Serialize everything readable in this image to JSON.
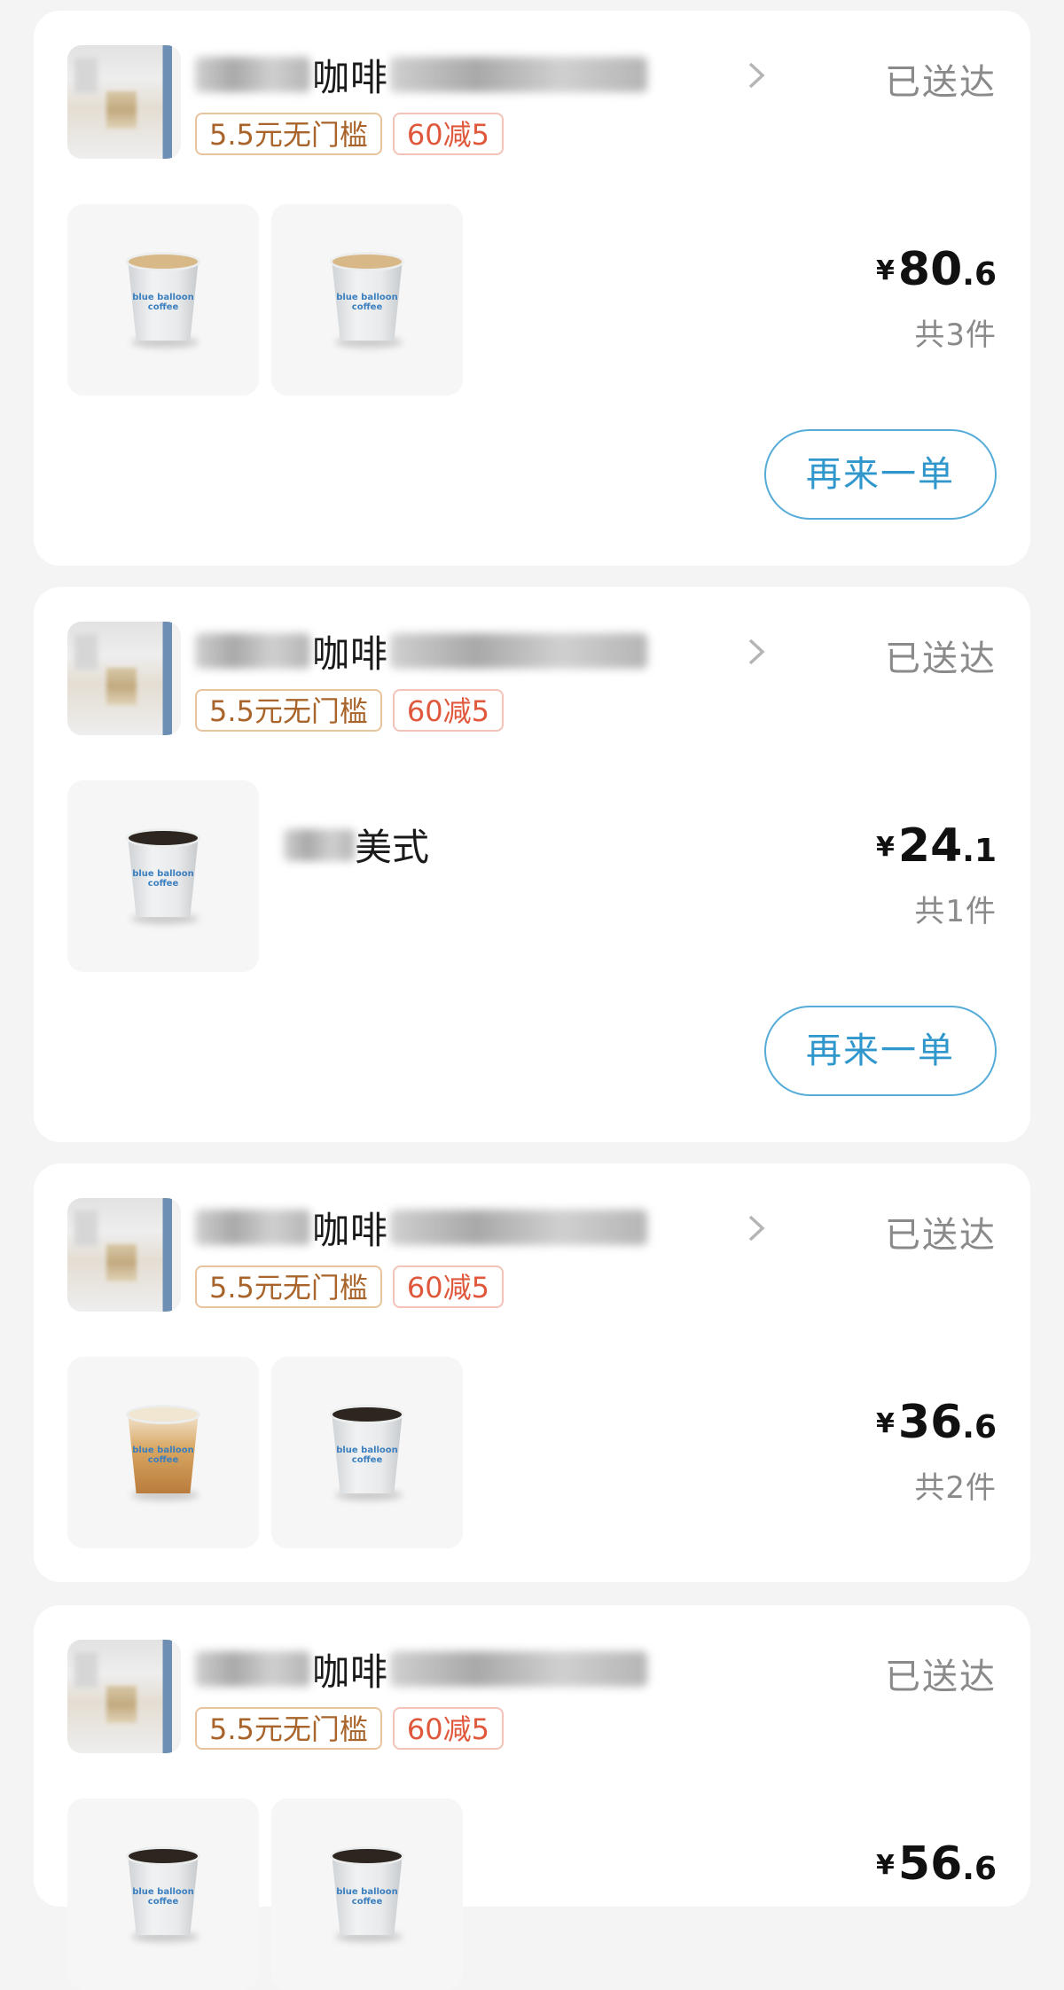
{
  "orders": [
    {
      "shop_name_visible": "咖啡",
      "status": "已送达",
      "tags": [
        "5.5元无门槛",
        "60减5"
      ],
      "price_int": "80",
      "price_dec": ".6",
      "currency": "¥",
      "count": "共3件",
      "reorder": "再来一单",
      "thumbs": [
        "latte-cup",
        "latte-cup"
      ]
    },
    {
      "shop_name_visible": "咖啡",
      "status": "已送达",
      "tags": [
        "5.5元无门槛",
        "60减5"
      ],
      "price_int": "24",
      "price_dec": ".1",
      "currency": "¥",
      "count": "共1件",
      "reorder": "再来一单",
      "item_name_visible": "美式",
      "thumbs": [
        "black-coffee-cup"
      ]
    },
    {
      "shop_name_visible": "咖啡",
      "status": "已送达",
      "tags": [
        "5.5元无门槛",
        "60减5"
      ],
      "price_int": "36",
      "price_dec": ".6",
      "currency": "¥",
      "count": "共2件",
      "thumbs": [
        "iced-latte-cup",
        "black-coffee-cup"
      ]
    },
    {
      "shop_name_visible": "咖啡",
      "status": "已送达",
      "tags": [
        "5.5元无门槛",
        "60减5"
      ],
      "price_int": "56",
      "price_dec": ".6",
      "currency": "¥",
      "thumbs": [
        "black-coffee-cup",
        "black-coffee-cup"
      ]
    }
  ],
  "cup_label": "blue balloon coffee",
  "colors": {
    "background": "#f4f4f5",
    "status_gray": "#8a8a8a",
    "tag_brown": "#a8642a",
    "tag_red": "#e0583c",
    "reorder_blue": "#3097cd"
  }
}
